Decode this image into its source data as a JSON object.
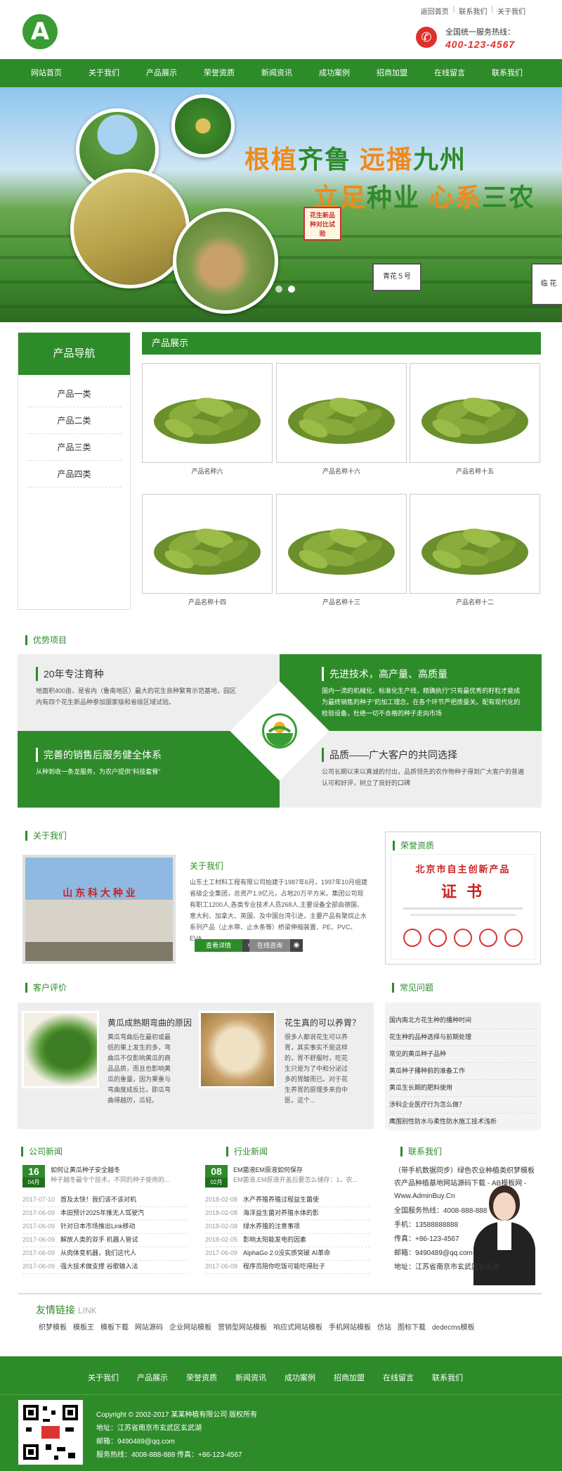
{
  "header": {
    "top_links": [
      "返回首页",
      "联系我们",
      "关于我们"
    ],
    "hotline_label": "全国统一服务热线：",
    "hotline_number": "400-123-4567",
    "logo_letter": "A"
  },
  "nav": [
    "网站首页",
    "关于我们",
    "产品展示",
    "荣誉资质",
    "新闻资讯",
    "成功案例",
    "招商加盟",
    "在线留言",
    "联系我们"
  ],
  "banner": {
    "slogan1_a": "根植",
    "slogan1_b": "齐鲁 ",
    "slogan1_c": "远播",
    "slogan1_d": "九州",
    "slogan2_a": "立足",
    "slogan2_b": "种业 ",
    "slogan2_c": "心系",
    "slogan2_d": "三农",
    "sign1": "花生新品种对比试验",
    "sign2": "青花５号",
    "sign3": "临 花"
  },
  "sidebar": {
    "title": "产品导航",
    "items": [
      "产品一类",
      "产品二类",
      "产品三类",
      "产品四类"
    ]
  },
  "products": {
    "title": "产品展示",
    "items": [
      "产品名称六",
      "产品名称十六",
      "产品名称十五",
      "产品名称十四",
      "产品名称十三",
      "产品名称十二"
    ]
  },
  "advantages": {
    "title": "优势项目",
    "a1_title": "20年专注育种",
    "a1_text": "地面积400亩，是省内（鲁南地区）最大的花生良种繁育示范基地，园区内有四个花生新品种参加国家级和省级区域试验。",
    "a2_title": "先进技术，高产量、高质量",
    "a2_text": "国内一流的机械化、标准化生产线，精确执行\"只有最优秀的籽粒才能成为最终销售的种子\"的加工理念，在各个环节严把质量关。配有现代化的检验设备，杜绝一切不合格的种子走向市场",
    "a3_title": "完善的销售后服务健全体系",
    "a3_text": "从种到收一条龙服务，为农户提供\"科技套餐\"",
    "a4_title": "品质——广大客户的共同选择",
    "a4_text": "公司长期以来以真诚的付出，品质领先的农作物种子得到广大客户的普遍认可和好评，树立了良好的口碑"
  },
  "about": {
    "section": "关于我们",
    "title": "关于我们",
    "text": "山东土工材料工程有限公司始建于1987年6月，1997年10月组建省级企业集团，总资产1.9亿元，占地20万平方米。集团公司现有职工1200人,各类专业技术人员268人,主要设备全部由德国、意大利、加拿大、英国、及中国台湾引进，主要产品有聚烷止水系列产品（止水带、止水条等）桥梁伸缩装置、PE、PVC、EVA、...",
    "btn_detail": "查看详情",
    "btn_consult": "在线咨询",
    "img_sign": "山 东 科 大 种 业"
  },
  "honor": {
    "section": "荣誉资质",
    "cert_line1": "北京市自主创新产品",
    "cert_line2": "证 书"
  },
  "reviews": {
    "section": "客户评价",
    "r1_title": "黄瓜成熟期弯曲的原因",
    "r1_text": "黄瓜弯曲后在最初或最低的果上发生的多，弯曲瓜不仅影响黄瓜的商品品质，而且也影响黄瓜的重量，因为果重与弯曲度成反比，即瓜弯曲得越厉，瓜轻。",
    "r2_title": "花生真的可以养胃？",
    "r2_text": "很多人都说花生可以养胃，其实事实不是这样的，胃不舒服时，吃花生只是为了中和分泌过多的胃酸而已。对于花生养胃的原理多来自中医，这个..."
  },
  "faq": {
    "section": "常见问题",
    "items": [
      "国内南北方花生种的播种时间",
      "花生种的品种选择与前期处理",
      "常见的黄瓜种子品种",
      "黄瓜种子播种前的准备工作",
      "黄瓜生长期的肥料使用",
      "涉科企业医疗行为怎么做？",
      "鹰围别性防水与柔性防水施工技术浅析"
    ]
  },
  "company_news": {
    "section": "公司新闻",
    "hl_day": "16",
    "hl_mon": "04月",
    "hl_title": "如何让黄瓜种子安全越冬",
    "hl_sum": "种子越冬最令个技术，不同的种子使用的...",
    "rows": [
      {
        "d": "2017-07-10",
        "t": "首及太快！我们该不该对机"
      },
      {
        "d": "2017-06-09",
        "t": "本田预计2025年推无人驾驶汽"
      },
      {
        "d": "2017-06-09",
        "t": "针对日本市场推出Link移动"
      },
      {
        "d": "2017-06-09",
        "t": "解放人类的双手 机器人管试"
      },
      {
        "d": "2017-06-09",
        "t": "从肉体变机器，我们这代人"
      },
      {
        "d": "2017-06-09",
        "t": "强大技术做支撑 谷歌输入法"
      }
    ]
  },
  "industry_news": {
    "section": "行业新闻",
    "hl_day": "08",
    "hl_mon": "02月",
    "hl_title": "EM菌液EM原液如何保存",
    "hl_sum": "EM菌液,EM原液开盖后要怎么储存：1，农...",
    "rows": [
      {
        "d": "2018-02-08",
        "t": "水产养殖养殖过程益生菌使"
      },
      {
        "d": "2018-02-08",
        "t": "海洋益生菌对养殖水体的影"
      },
      {
        "d": "2018-02-08",
        "t": "绿水养殖的注意事项"
      },
      {
        "d": "2018-02-05",
        "t": "影响太阳能发电的因素"
      },
      {
        "d": "2017-06-09",
        "t": "AlphaGo 2.0没实质突破 AI革命"
      },
      {
        "d": "2017-06-09",
        "t": "程序员陪你吃饭可能吃得肚子"
      }
    ]
  },
  "contact": {
    "section": "联系我们",
    "desc": "（带手机数据同步）绿色农业种植类织梦模板 农产品种植基地网站源码下载 - AB模板网 - Www.AdminBuy.Cn",
    "hotline": "全国服务热线：4008-888-888",
    "mobile": "手机：13588888888",
    "fax": "传真：+86-123-4567",
    "email": "邮箱：9490489@qq.com",
    "address": "地址：江苏省南京市玄武区玄武湖"
  },
  "links": {
    "title": "友情链接",
    "title_en": "LINK",
    "items": [
      "织梦模板",
      "模板王",
      "模板下载",
      "网站源码",
      "企业网站模板",
      "营销型网站模板",
      "响应式网站模板",
      "手机网站模板",
      "仿站",
      "图标下载",
      "dedecms模板"
    ]
  },
  "footer": {
    "nav": [
      "关于我们",
      "产品展示",
      "荣誉资质",
      "新闻资讯",
      "成功案例",
      "招商加盟",
      "在线留言",
      "联系我们"
    ],
    "copyright": "Copyright © 2002-2017 某某种植有限公司 版权所有",
    "address": "地址：江苏省南京市玄武区玄武湖",
    "email": "邮箱：9490489@qq.com",
    "hotline": "服务热线：4008-888-888 传真：+86-123-4567"
  },
  "colors": {
    "brand_green": "#2e8b2a",
    "accent_orange": "#f08a1a",
    "hotline_red": "#e0302a"
  }
}
